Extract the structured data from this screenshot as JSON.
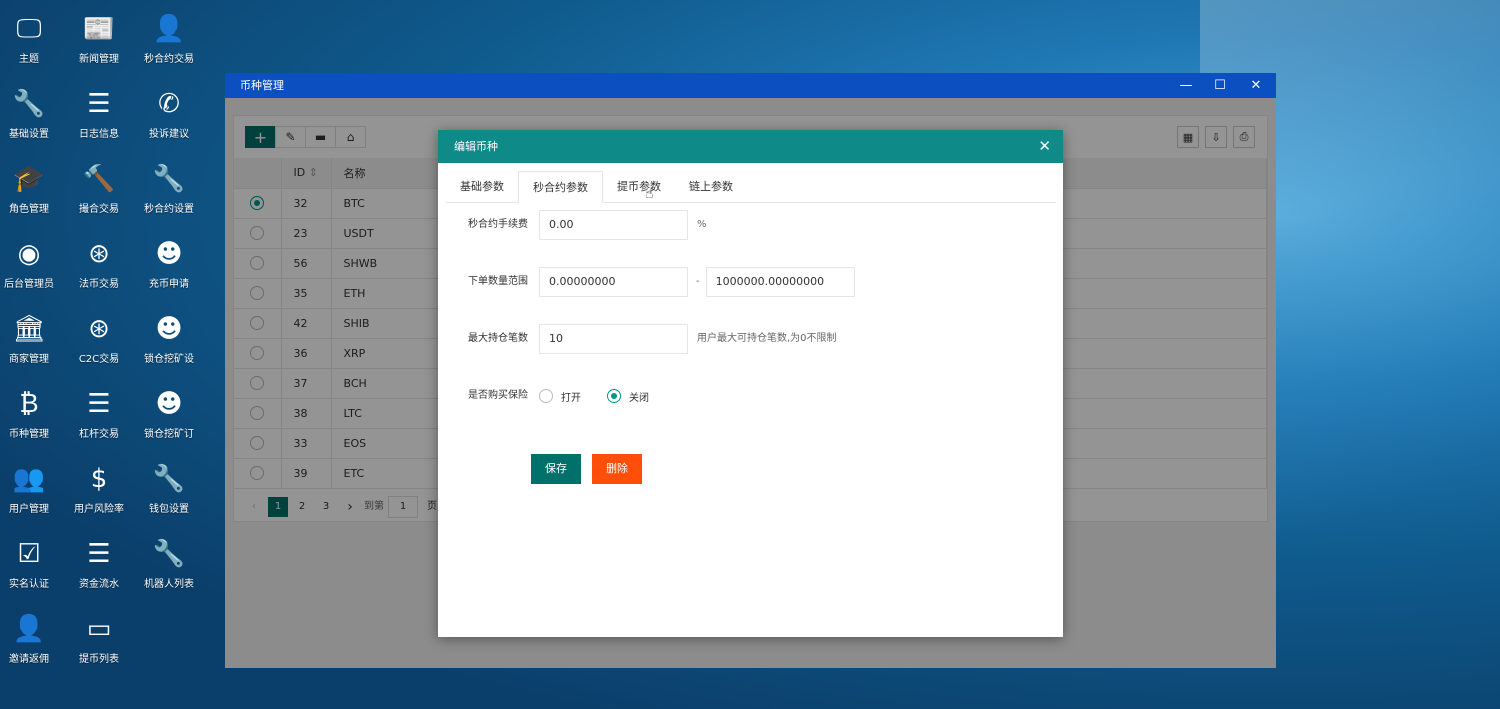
{
  "desktop": [
    {
      "label": "主题",
      "icon": "monitor-icon",
      "glyph": "🖵"
    },
    {
      "label": "新闻管理",
      "icon": "newspaper-icon",
      "glyph": "📰"
    },
    {
      "label": "秒合约交易",
      "icon": "user-plus-icon",
      "glyph": "👤"
    },
    {
      "label": "基础设置",
      "icon": "wrench-icon",
      "glyph": "🔧"
    },
    {
      "label": "日志信息",
      "icon": "list-icon",
      "glyph": "☰"
    },
    {
      "label": "投诉建议",
      "icon": "phone-icon",
      "glyph": "✆"
    },
    {
      "label": "角色管理",
      "icon": "graduation-cap-icon",
      "glyph": "🎓"
    },
    {
      "label": "撮合交易",
      "icon": "gavel-icon",
      "glyph": "🔨"
    },
    {
      "label": "秒合约设置",
      "icon": "wrench-icon",
      "glyph": "🔧"
    },
    {
      "label": "后台管理员",
      "icon": "user-circle-icon",
      "glyph": "◉"
    },
    {
      "label": "法币交易",
      "icon": "exchange-icon",
      "glyph": "⊛"
    },
    {
      "label": "充币申请",
      "icon": "reddit-icon",
      "glyph": "☻"
    },
    {
      "label": "商家管理",
      "icon": "bank-icon",
      "glyph": "🏛"
    },
    {
      "label": "C2C交易",
      "icon": "exchange-icon",
      "glyph": "⊛"
    },
    {
      "label": "锁仓挖矿设",
      "icon": "reddit-icon",
      "glyph": "☻"
    },
    {
      "label": "币种管理",
      "icon": "bitcoin-icon",
      "glyph": "₿"
    },
    {
      "label": "杠杆交易",
      "icon": "list-icon",
      "glyph": "☰"
    },
    {
      "label": "锁仓挖矿订",
      "icon": "reddit-icon",
      "glyph": "☻"
    },
    {
      "label": "用户管理",
      "icon": "users-icon",
      "glyph": "👥"
    },
    {
      "label": "用户风险率",
      "icon": "dollar-icon",
      "glyph": "$"
    },
    {
      "label": "钱包设置",
      "icon": "wrench-icon",
      "glyph": "🔧"
    },
    {
      "label": "实名认证",
      "icon": "check-square-icon",
      "glyph": "☑"
    },
    {
      "label": "资金流水",
      "icon": "list-icon",
      "glyph": "☰"
    },
    {
      "label": "机器人列表",
      "icon": "wrench-icon",
      "glyph": "🔧"
    },
    {
      "label": "邀请返佣",
      "icon": "user-plus-icon",
      "glyph": "👤"
    },
    {
      "label": "提币列表",
      "icon": "credit-card-icon",
      "glyph": "▭"
    }
  ],
  "window": {
    "title": "币种管理",
    "min": "—",
    "max": "☐",
    "close": "✕"
  },
  "table": {
    "headers": [
      "ID",
      "名称"
    ],
    "sort_glyph": "⇕",
    "rows": [
      [
        "32",
        "BTC"
      ],
      [
        "23",
        "USDT"
      ],
      [
        "56",
        "SHWB"
      ],
      [
        "35",
        "ETH"
      ],
      [
        "42",
        "SHIB"
      ],
      [
        "36",
        "XRP"
      ],
      [
        "37",
        "BCH"
      ],
      [
        "38",
        "LTC"
      ],
      [
        "33",
        "EOS"
      ],
      [
        "39",
        "ETC"
      ]
    ],
    "selected": 0
  },
  "toolbar": {
    "add": "+",
    "edit": "✎",
    "monitor": "▬",
    "tag": "⌂"
  },
  "pager": {
    "prev": "‹",
    "pages": [
      "1",
      "2",
      "3"
    ],
    "current": "1",
    "next": "›",
    "goto": "到第",
    "goto_value": "1",
    "page_suffix": "页"
  },
  "modal": {
    "title": "编辑币种",
    "close": "✕",
    "tabs": [
      "基础参数",
      "秒合约参数",
      "提币参数",
      "链上参数"
    ],
    "active_tab": 1,
    "fields": {
      "fee": {
        "label": "秒合约手续费",
        "value": "0.00",
        "suffix": "%"
      },
      "range": {
        "label": "下单数量范围",
        "min": "0.00000000",
        "sep": "-",
        "max": "1000000.00000000"
      },
      "max_pos": {
        "label": "最大持仓笔数",
        "value": "10",
        "hint": "用户最大可持仓笔数,为0不限制"
      },
      "insurance": {
        "label": "是否购买保险",
        "options": [
          "打开",
          "关闭"
        ],
        "selected": 1
      }
    },
    "save": "保存",
    "delete": "删除"
  },
  "colors": {
    "teal": "#0e8a89",
    "save": "#00706b",
    "delete": "#ff4d0a",
    "titlebar": "#0b4fc0"
  }
}
